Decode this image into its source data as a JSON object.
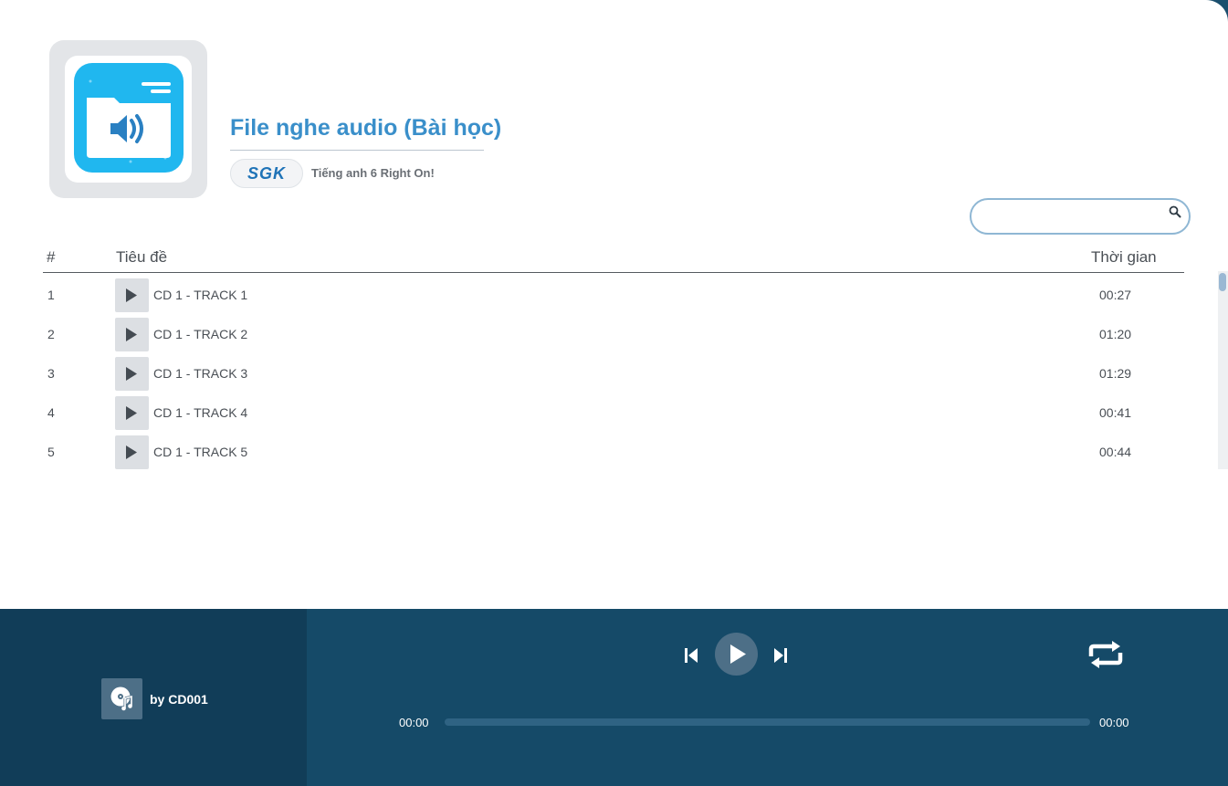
{
  "album": {
    "title": "File nghe audio (Bài học)",
    "badge": "SGK",
    "subtitle": "Tiếng anh 6 Right On!",
    "cover_icon": "audio-folder-icon"
  },
  "search": {
    "value": "",
    "placeholder": ""
  },
  "table": {
    "headers": {
      "num": "#",
      "title": "Tiêu đề",
      "duration": "Thời gian"
    },
    "rows": [
      {
        "num": "1",
        "title": "CD 1 - TRACK 1",
        "duration": "00:27"
      },
      {
        "num": "2",
        "title": "CD 1 - TRACK 2",
        "duration": "01:20"
      },
      {
        "num": "3",
        "title": "CD 1 - TRACK 3",
        "duration": "01:29"
      },
      {
        "num": "4",
        "title": "CD 1 - TRACK 4",
        "duration": "00:41"
      },
      {
        "num": "5",
        "title": "CD 1 - TRACK 5",
        "duration": "00:44"
      }
    ]
  },
  "player": {
    "byline": "by CD001",
    "current_time": "00:00",
    "total_time": "00:00",
    "progress": 0
  },
  "colors": {
    "accent": "#3a8fca",
    "player_bg": "#154a68",
    "player_left_bg": "#113d58",
    "button_bg": "#4d6f87"
  }
}
